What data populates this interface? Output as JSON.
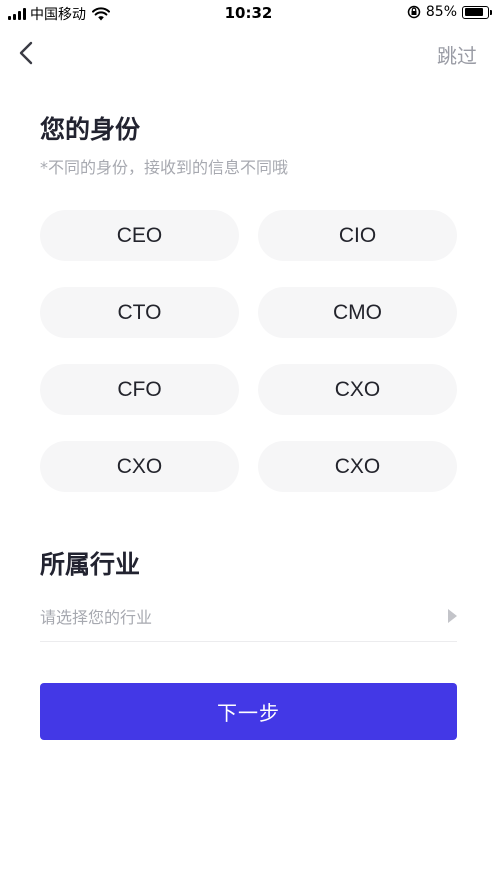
{
  "status_bar": {
    "carrier": "中国移动",
    "time": "10:32",
    "battery_percent": "85%",
    "battery_level": 0.85
  },
  "nav": {
    "back_icon": "chevron-left-icon",
    "skip_label": "跳过"
  },
  "identity": {
    "title": "您的身份",
    "subtitle": "*不同的身份，接收到的信息不同哦",
    "roles": [
      "CEO",
      "CIO",
      "CTO",
      "CMO",
      "CFO",
      "CXO",
      "CXO",
      "CXO"
    ]
  },
  "industry": {
    "title": "所属行业",
    "placeholder": "请选择您的行业"
  },
  "actions": {
    "next_label": "下一步"
  },
  "colors": {
    "primary": "#4338e6",
    "option_bg": "#f6f6f7",
    "muted_text": "#a7a9b0"
  }
}
